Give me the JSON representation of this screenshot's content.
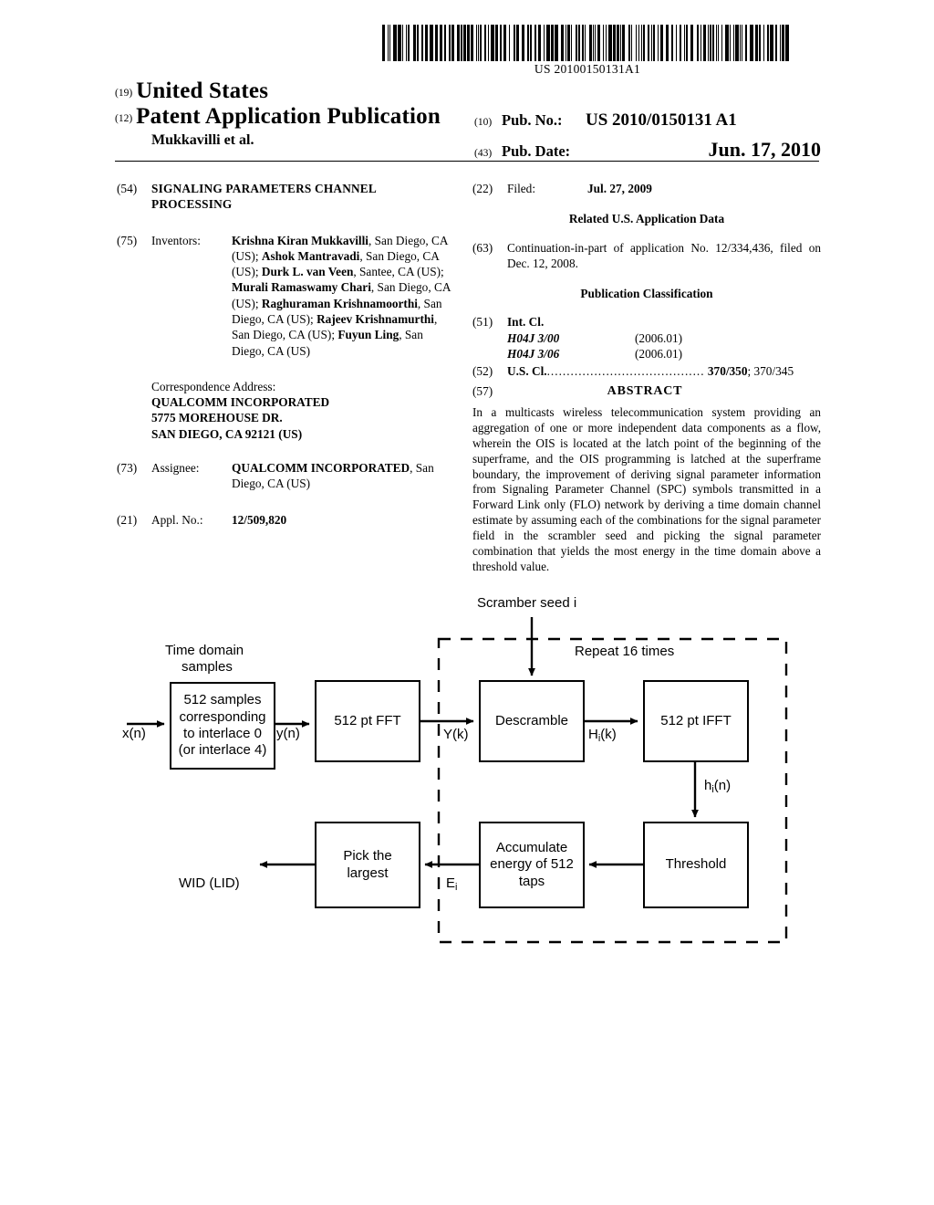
{
  "barcode": {
    "number": "US 20100150131A1"
  },
  "masthead": {
    "tag_19": "(19)",
    "country": "United States",
    "tag_12": "(12)",
    "pub_type": "Patent Application Publication",
    "author_line": "Mukkavilli et al.",
    "tag_10": "(10)",
    "pub_no_label": "Pub. No.:",
    "pub_no_value": "US 2010/0150131 A1",
    "tag_43": "(43)",
    "pub_date_label": "Pub. Date:",
    "pub_date_value": "Jun. 17, 2010"
  },
  "left_column": {
    "title_num": "(54)",
    "title_line1": "SIGNALING PARAMETERS CHANNEL",
    "title_line2": "PROCESSING",
    "inventors_num": "(75)",
    "inventors_label": "Inventors:",
    "inventors_html": "<b>Krishna Kiran Mukkavilli</b>, San Diego, CA (US); <b>Ashok Mantravadi</b>, San Diego, CA (US); <b>Durk L. van Veen</b>, Santee, CA (US); <b>Murali Ramaswamy Chari</b>, San Diego, CA (US); <b>Raghuraman Krishnamoorthi</b>, San Diego, CA (US); <b>Rajeev Krishnamurthi</b>, San Diego, CA (US); <b>Fuyun Ling</b>, San Diego, CA (US)",
    "correspondence_heading": "Correspondence Address:",
    "correspondence_line1": "QUALCOMM INCORPORATED",
    "correspondence_line2": "5775 MOREHOUSE DR.",
    "correspondence_line3": "SAN DIEGO, CA 92121 (US)",
    "assignee_num": "(73)",
    "assignee_label": "Assignee:",
    "assignee_html": "<b>QUALCOMM INCORPORATED</b>, San Diego, CA (US)",
    "applno_num": "(21)",
    "applno_label": "Appl. No.:",
    "applno_value": "12/509,820"
  },
  "right_column": {
    "filed_num": "(22)",
    "filed_label": "Filed:",
    "filed_value": "Jul. 27, 2009",
    "related_heading": "Related U.S. Application Data",
    "continuation_num": "(63)",
    "continuation_text": "Continuation-in-part of application No. 12/334,436, filed on Dec. 12, 2008.",
    "classification_heading": "Publication Classification",
    "intcl_num": "(51)",
    "intcl_label": "Int. Cl.",
    "intcl_rows": [
      {
        "code": "H04J 3/00",
        "edition": "(2006.01)"
      },
      {
        "code": "H04J 3/06",
        "edition": "(2006.01)"
      }
    ],
    "uscl_num": "(52)",
    "uscl_label": "U.S. Cl.",
    "uscl_dots": "........................................",
    "uscl_value_bold": "370/350",
    "uscl_value_rest": "; 370/345",
    "abstract_num": "(57)",
    "abstract_title": "ABSTRACT",
    "abstract_text": "In a multicasts wireless telecommunication system providing an aggregation of one or more independent data components as a flow, wherein the OIS is located at the latch point of the beginning of the superframe, and the OIS programming is latched at the superframe boundary, the improvement of deriving signal parameter information from Signaling Parameter Channel (SPC) symbols transmitted in a Forward Link only (FLO) network by deriving a time domain channel estimate by assuming each of the combinations for the signal parameter field in the scrambler seed and picking the signal parameter combination that yields the most energy in the time domain above a threshold value."
  },
  "figure": {
    "scrambler_seed_label": "Scramber seed i",
    "time_domain_label_line1": "Time domain",
    "time_domain_label_line2": "samples",
    "repeat_label": "Repeat 16 times",
    "input_label": "x(n)",
    "yn_label": "y(n)",
    "yk_label": "Y(k)",
    "hik_label_main": "H",
    "hik_label_sub": "i",
    "hik_label_tail": "(k)",
    "hin_label_main": "h",
    "hin_label_sub": "i",
    "hin_label_tail": "(n)",
    "ei_label_main": "E",
    "ei_label_sub": "i",
    "output_label": "WID (LID)",
    "boxes": {
      "samples": "512 samples corresponding to interlace 0 (or interlace 4)",
      "samples_lines": [
        "512 samples",
        "corresponding",
        "to interlace 0",
        "(or interlace 4)"
      ],
      "fft": "512 pt FFT",
      "descramble": "Descramble",
      "ifft": "512 pt IFFT",
      "threshold": "Threshold",
      "accumulate_lines": [
        "Accumulate",
        "energy of 512",
        "taps"
      ],
      "pick_lines": [
        "Pick the",
        "largest"
      ]
    }
  }
}
